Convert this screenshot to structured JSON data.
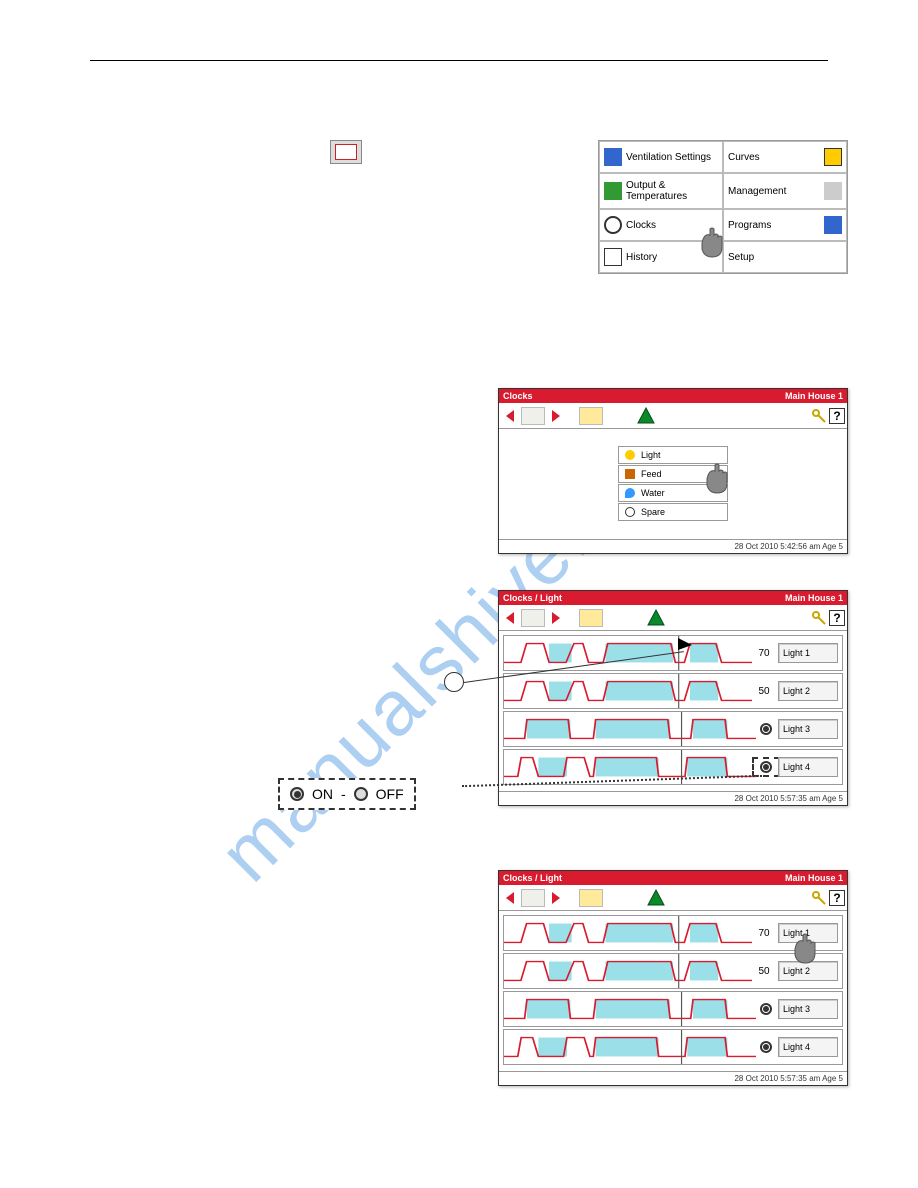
{
  "watermark": "manualshive.com",
  "menubox": {
    "rows": [
      [
        {
          "label": "Ventilation Settings"
        },
        {
          "label": "Curves"
        }
      ],
      [
        {
          "label": "Output & Temperatures"
        },
        {
          "label": "Management"
        }
      ],
      [
        {
          "label": "Clocks"
        },
        {
          "label": "Programs"
        }
      ],
      [
        {
          "label": "History"
        },
        {
          "label": "Setup"
        }
      ]
    ]
  },
  "screen_clocks": {
    "title_left": "Clocks",
    "title_right": "Main House 1",
    "menu": [
      {
        "label": "Light"
      },
      {
        "label": "Feed"
      },
      {
        "label": "Water"
      },
      {
        "label": "Spare"
      }
    ],
    "footer": "28 Oct 2010   5:42:56 am   Age       5"
  },
  "screen_light1": {
    "title_left": "Clocks / Light",
    "title_right": "Main House 1",
    "rows": [
      {
        "val": "70",
        "label": "Light 1",
        "radio": null
      },
      {
        "val": "50",
        "label": "Light 2",
        "radio": null
      },
      {
        "val": "",
        "label": "Light 3",
        "radio": "on"
      },
      {
        "val": "",
        "label": "Light 4",
        "radio": "on"
      }
    ],
    "footer": "28 Oct 2010   5:57:35 am   Age       5"
  },
  "screen_light2": {
    "title_left": "Clocks / Light",
    "title_right": "Main House 1",
    "rows": [
      {
        "val": "70",
        "label": "Light 1",
        "radio": null
      },
      {
        "val": "50",
        "label": "Light 2",
        "radio": null
      },
      {
        "val": "",
        "label": "Light 3",
        "radio": "on"
      },
      {
        "val": "",
        "label": "Light 4",
        "radio": "on"
      }
    ],
    "footer": "28 Oct 2010   5:57:35 am   Age       5"
  },
  "onoff": {
    "on": "ON",
    "dash": "-",
    "off": "OFF"
  },
  "help_char": "?"
}
